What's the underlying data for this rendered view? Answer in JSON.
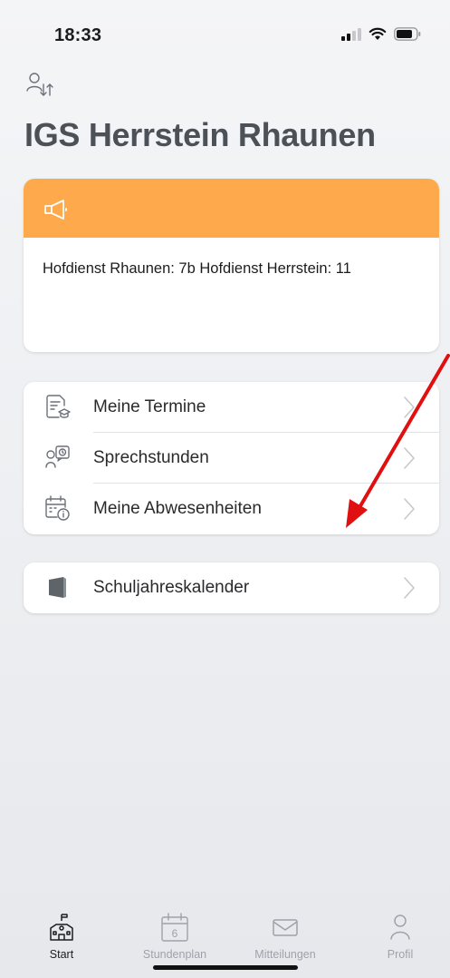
{
  "status_bar": {
    "time": "18:33"
  },
  "header": {
    "title": "IGS Herrstein Rhaunen"
  },
  "announcement": {
    "text": "Hofdienst Rhaunen: 7b Hofdienst Herrstein: 11",
    "accent_color": "#ffa94d"
  },
  "menu_group_1": {
    "items": [
      {
        "label": "Meine Termine",
        "icon": "calendar-graduation-icon"
      },
      {
        "label": "Sprechstunden",
        "icon": "consultation-icon"
      },
      {
        "label": "Meine Abwesenheiten",
        "icon": "calendar-info-icon"
      }
    ]
  },
  "menu_group_2": {
    "items": [
      {
        "label": "Schuljahreskalender",
        "icon": "book-icon"
      }
    ]
  },
  "tabbar": {
    "tabs": [
      {
        "label": "Start",
        "icon": "school-icon",
        "active": true
      },
      {
        "label": "Stundenplan",
        "icon": "calendar-day-icon",
        "day": "6",
        "active": false
      },
      {
        "label": "Mitteilungen",
        "icon": "envelope-icon",
        "active": false
      },
      {
        "label": "Profil",
        "icon": "person-icon",
        "active": false
      }
    ]
  }
}
